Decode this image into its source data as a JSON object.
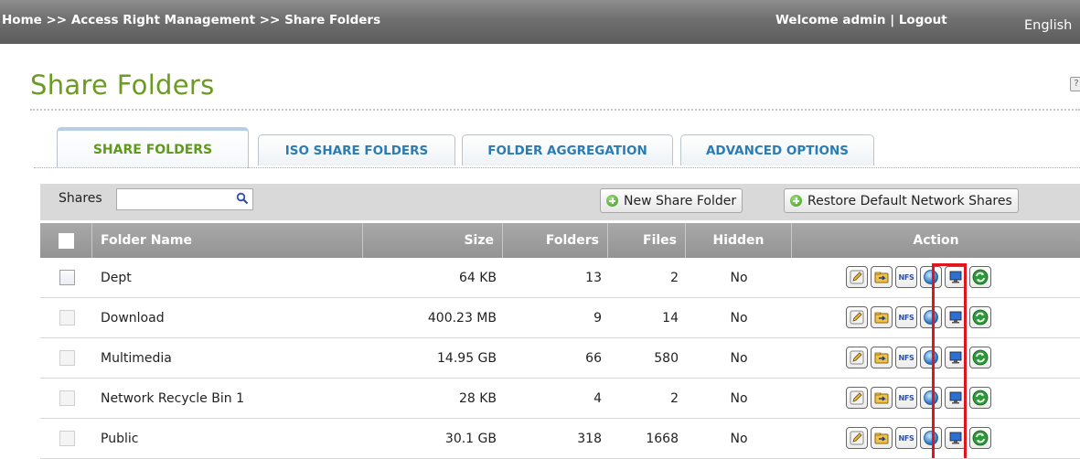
{
  "topbar": {
    "crumb_home": "Home",
    "crumb_sep1": ">>",
    "crumb_access": "Access Right Management",
    "crumb_sep2": ">>",
    "crumb_current": "Share Folders",
    "welcome": "Welcome admin",
    "divider": "|",
    "logout": "Logout",
    "language": "English"
  },
  "page": {
    "title": "Share Folders",
    "help_icon": "help-icon"
  },
  "tabs": [
    {
      "label": "SHARE FOLDERS",
      "active": true
    },
    {
      "label": "ISO SHARE FOLDERS",
      "active": false
    },
    {
      "label": "FOLDER AGGREGATION",
      "active": false
    },
    {
      "label": "ADVANCED OPTIONS",
      "active": false
    }
  ],
  "toolbar": {
    "shares_label": "Shares",
    "search_value": "",
    "search_icon": "magnifier-icon",
    "new_share_label": "New Share Folder",
    "restore_label": "Restore Default Network Shares"
  },
  "table": {
    "columns": [
      "Folder Name",
      "Size",
      "Folders",
      "Files",
      "Hidden",
      "Action"
    ],
    "rows": [
      {
        "name": "Dept",
        "size": "64 KB",
        "folders": "13",
        "files": "2",
        "hidden": "No",
        "selectable": true
      },
      {
        "name": "Download",
        "size": "400.23 MB",
        "folders": "9",
        "files": "14",
        "hidden": "No",
        "selectable": false
      },
      {
        "name": "Multimedia",
        "size": "14.95 GB",
        "folders": "66",
        "files": "580",
        "hidden": "No",
        "selectable": false
      },
      {
        "name": "Network Recycle Bin 1",
        "size": "28 KB",
        "folders": "4",
        "files": "2",
        "hidden": "No",
        "selectable": false
      },
      {
        "name": "Public",
        "size": "30.1 GB",
        "folders": "318",
        "files": "1668",
        "hidden": "No",
        "selectable": false
      }
    ],
    "action_icons": [
      "edit-pencil-icon",
      "folder-permission-icon",
      "nfs-icon",
      "network-globe-icon",
      "monitor-icon",
      "refresh-icon"
    ],
    "nfs_text": "NFS"
  },
  "colors": {
    "title_green": "#6b9b22",
    "tab_blue": "#2b7bb5",
    "highlight_red": "#e0151f"
  }
}
